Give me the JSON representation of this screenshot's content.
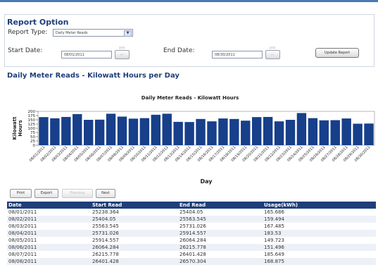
{
  "report_option": {
    "title": "Report Option",
    "report_type_label": "Report Type:",
    "report_type_value": "Daily Meter Reads",
    "start_date_label": "Start Date:",
    "start_date_value": "08/01/2011",
    "end_date_label": "End Date:",
    "end_date_value": "08/30/2011",
    "calendar_caption": "????",
    "calendar_button_label": "...",
    "update_label": "Update Report"
  },
  "section_title": "Daily Meter Reads - Kilowatt Hours per Day",
  "colors": {
    "bar": "#173f8a",
    "header": "#1f3f7a",
    "accent": "#4a78b5"
  },
  "chart_data": {
    "type": "bar",
    "title": "Daily Meter Reads - Kilowatt Hours",
    "xlabel": "Day",
    "ylabel": "Kilowatt Hours",
    "ylim": [
      0,
      200
    ],
    "yticks": [
      0,
      25,
      50,
      75,
      100,
      125,
      150,
      175,
      200
    ],
    "grid": false,
    "categories": [
      "08/01/2011",
      "08/02/2011",
      "08/03/2011",
      "08/04/2011",
      "08/05/2011",
      "08/06/2011",
      "08/07/2011",
      "08/08/2011",
      "08/09/2011",
      "08/10/2011",
      "08/11/2011",
      "08/12/2011",
      "08/13/2011",
      "08/14/2011",
      "08/15/2011",
      "08/16/2011",
      "08/17/2011",
      "08/18/2011",
      "08/19/2011",
      "08/20/2011",
      "08/21/2011",
      "08/22/2011",
      "08/23/2011",
      "08/24/2011",
      "08/25/2011",
      "08/26/2011",
      "08/27/2011",
      "08/28/2011",
      "08/29/2011",
      "08/30/2011"
    ],
    "values": [
      166,
      159,
      167,
      184,
      150,
      151,
      186,
      169,
      157,
      160,
      180,
      186,
      138,
      137,
      155,
      141,
      158,
      155,
      145,
      166,
      167,
      141,
      150,
      190,
      160,
      147,
      148,
      158,
      127,
      128
    ]
  },
  "pager": {
    "print": "Print",
    "export": "Export",
    "previous": "Previous",
    "next": "Next"
  },
  "table": {
    "headers": [
      "Date",
      "Start Read",
      "End Read",
      "Usage(kWh)"
    ],
    "rows": [
      [
        "08/01/2011",
        "25238.364",
        "25404.05",
        "165.686"
      ],
      [
        "08/02/2011",
        "25404.05",
        "25563.545",
        "159.494"
      ],
      [
        "08/03/2011",
        "25563.545",
        "25731.026",
        "167.485"
      ],
      [
        "08/04/2011",
        "25731.026",
        "25914.557",
        "183.53"
      ],
      [
        "08/05/2011",
        "25914.557",
        "26064.284",
        "149.723"
      ],
      [
        "08/06/2011",
        "26064.284",
        "26215.778",
        "151.496"
      ],
      [
        "08/07/2011",
        "26215.778",
        "26401.428",
        "185.649"
      ],
      [
        "08/08/2011",
        "26401.428",
        "26570.304",
        "168.875"
      ]
    ]
  }
}
